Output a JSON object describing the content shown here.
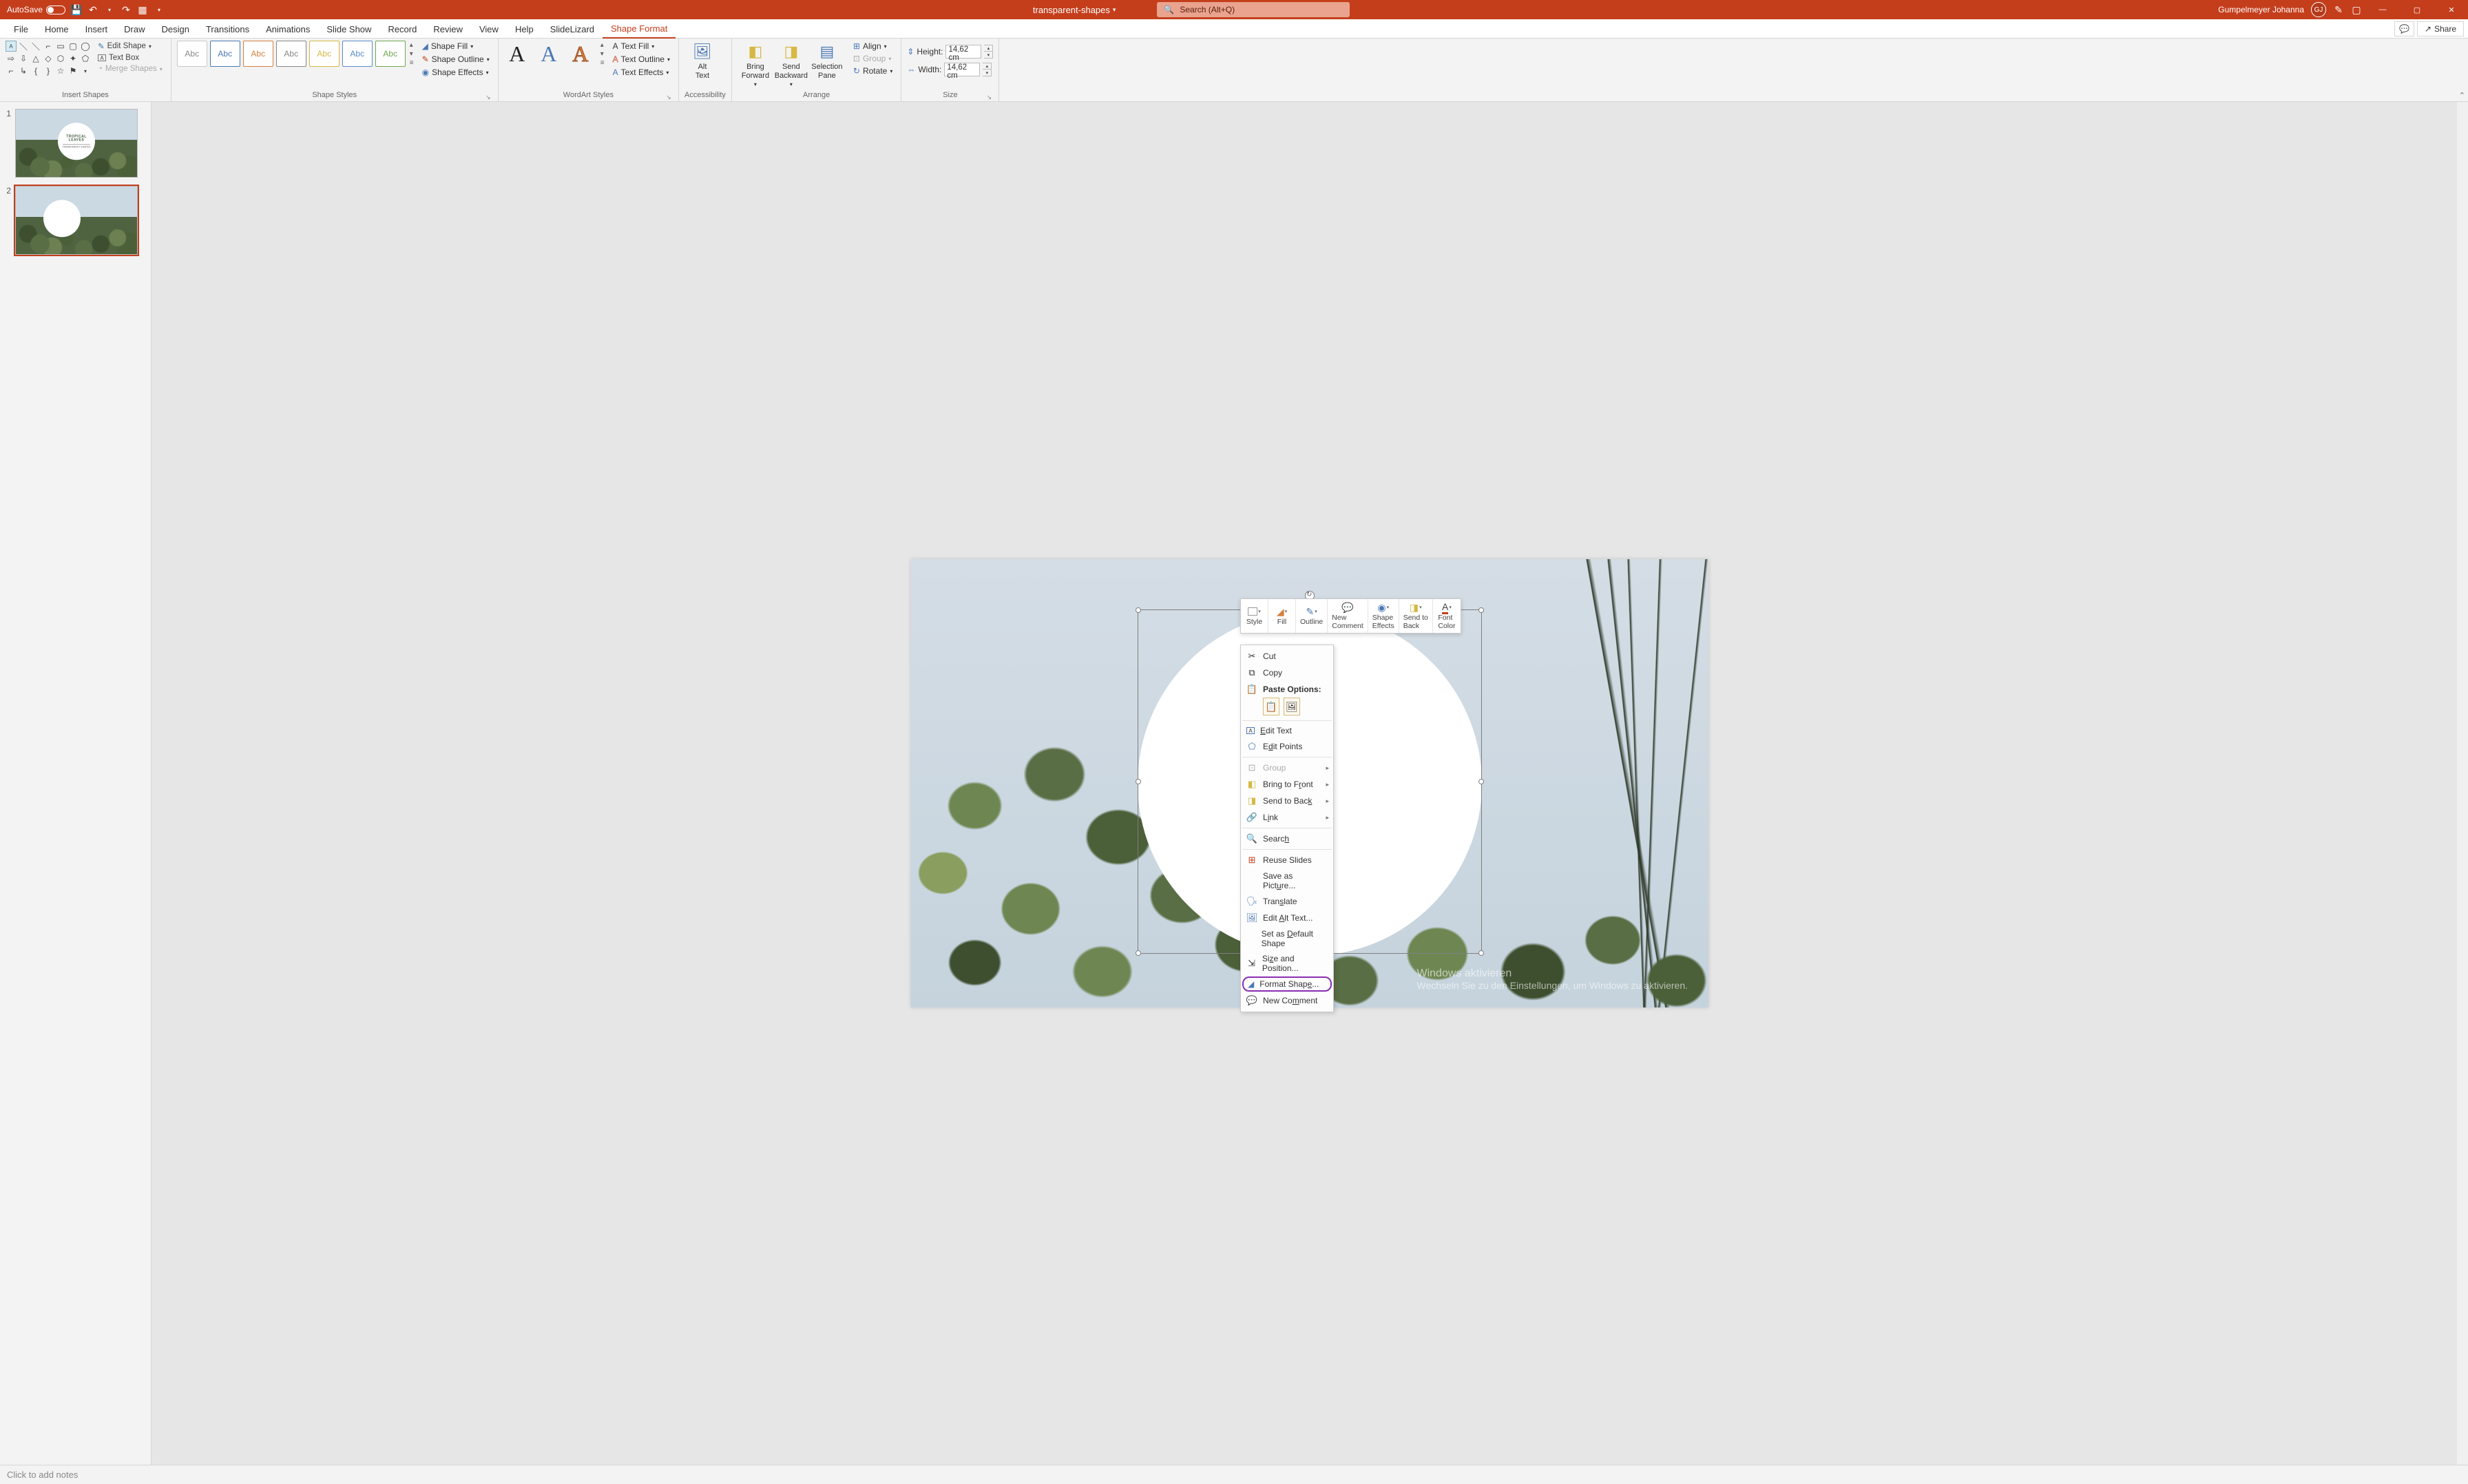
{
  "titlebar": {
    "autosave": "AutoSave",
    "autosave_state": "Off",
    "filename": "transparent-shapes",
    "search_placeholder": "Search (Alt+Q)",
    "user": "Gumpelmeyer Johanna",
    "user_initials": "GJ"
  },
  "tabs": {
    "file": "File",
    "home": "Home",
    "insert": "Insert",
    "draw": "Draw",
    "design": "Design",
    "transitions": "Transitions",
    "animations": "Animations",
    "slideshow": "Slide Show",
    "record": "Record",
    "review": "Review",
    "view": "View",
    "help": "Help",
    "slidelizard": "SlideLizard",
    "shapeformat": "Shape Format",
    "share": "Share"
  },
  "ribbon": {
    "insert_shapes": {
      "edit_shape": "Edit Shape",
      "text_box": "Text Box",
      "merge_shapes": "Merge Shapes",
      "group": "Insert Shapes"
    },
    "shape_styles": {
      "sample": "Abc",
      "shape_fill": "Shape Fill",
      "shape_outline": "Shape Outline",
      "shape_effects": "Shape Effects",
      "group": "Shape Styles"
    },
    "wordart_styles": {
      "text_fill": "Text Fill",
      "text_outline": "Text Outline",
      "text_effects": "Text Effects",
      "group": "WordArt Styles"
    },
    "accessibility": {
      "alt_text": "Alt\nText",
      "group": "Accessibility"
    },
    "arrange": {
      "bring_forward": "Bring\nForward",
      "send_backward": "Send\nBackward",
      "selection_pane": "Selection\nPane",
      "align": "Align",
      "group_btn": "Group",
      "rotate": "Rotate",
      "group": "Arrange"
    },
    "size": {
      "height_label": "Height:",
      "height_value": "14,62 cm",
      "width_label": "Width:",
      "width_value": "14,62 cm",
      "group": "Size"
    }
  },
  "thumbs": {
    "slide1": {
      "num": "1",
      "title1": "TROPICAL",
      "title2": "LEAVES",
      "sub": "TRANSPARENT SHAPES"
    },
    "slide2": {
      "num": "2"
    }
  },
  "mini_toolbar": {
    "style": "Style",
    "fill": "Fill",
    "outline": "Outline",
    "new_comment": "New\nComment",
    "shape_effects": "Shape\nEffects",
    "send_back": "Send to\nBack",
    "font_color": "Font\nColor"
  },
  "ctx": {
    "cut": "Cut",
    "copy": "Copy",
    "paste_options": "Paste Options:",
    "edit_text": "Edit Text",
    "edit_points": "Edit Points",
    "group": "Group",
    "bring_front": "Bring to Front",
    "send_back": "Send to Back",
    "link": "Link",
    "search": "Search",
    "reuse": "Reuse Slides",
    "save_pic": "Save as Picture...",
    "translate": "Translate",
    "alt_text": "Edit Alt Text...",
    "set_default": "Set as Default Shape",
    "size_pos": "Size and Position...",
    "format_shape": "Format Shape...",
    "new_comment": "New Comment"
  },
  "notes": {
    "placeholder": "Click to add notes"
  },
  "watermark": {
    "line1": "Windows aktivieren",
    "line2": "Wechseln Sie zu den Einstellungen, um Windows zu aktivieren."
  }
}
